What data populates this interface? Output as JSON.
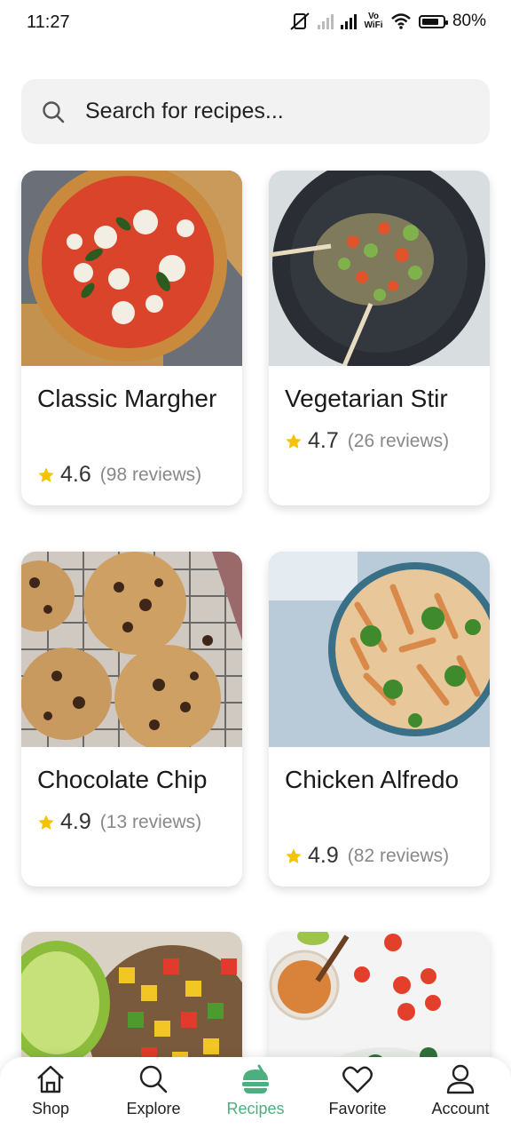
{
  "status_bar": {
    "time": "11:27",
    "vowifi": "Vo WiFi",
    "battery": "80%",
    "battery_level": 0.8
  },
  "search": {
    "placeholder": "Search for recipes..."
  },
  "recipes": [
    {
      "title": "Classic Margher",
      "rating": "4.6",
      "reviews": "(98 reviews)",
      "image": "pizza-margherita"
    },
    {
      "title": "Vegetarian Stir",
      "rating": "4.7",
      "reviews": "(26 reviews)",
      "image": "vegetable-stir-fry"
    },
    {
      "title": "Chocolate Chip",
      "rating": "4.9",
      "reviews": "(13 reviews)",
      "image": "chocolate-chip-cookies"
    },
    {
      "title": "Chicken Alfredo",
      "rating": "4.9",
      "reviews": "(82 reviews)",
      "image": "chicken-alfredo-penne"
    },
    {
      "title": "",
      "rating": "",
      "reviews": "",
      "image": "mango-salsa-lime"
    },
    {
      "title": "",
      "rating": "",
      "reviews": "",
      "image": "salad-bowl-dressing"
    }
  ],
  "nav": {
    "active": "Recipes",
    "accent_color": "#4caf80",
    "items": [
      {
        "label": "Shop",
        "icon": "home-icon"
      },
      {
        "label": "Explore",
        "icon": "search-icon"
      },
      {
        "label": "Recipes",
        "icon": "recipe-icon"
      },
      {
        "label": "Favorite",
        "icon": "heart-icon"
      },
      {
        "label": "Account",
        "icon": "user-icon"
      }
    ]
  },
  "colors": {
    "star": "#f5c400",
    "accent": "#4caf80",
    "search_bg": "#f2f2f2"
  }
}
